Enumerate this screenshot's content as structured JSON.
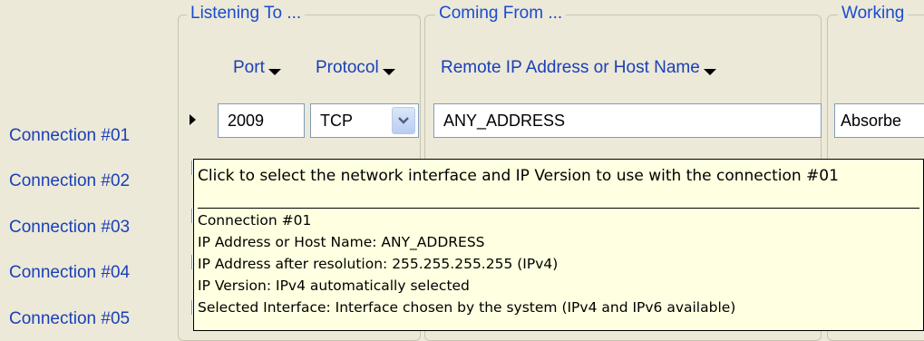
{
  "groups": {
    "listening": "Listening To ...",
    "coming_from": "Coming From ...",
    "working": "Working"
  },
  "columns": {
    "port": "Port",
    "protocol": "Protocol",
    "remote": "Remote IP Address or Host Name"
  },
  "rows": [
    "Connection #01",
    "Connection #02",
    "Connection #03",
    "Connection #04",
    "Connection #05"
  ],
  "row1": {
    "port": "2009",
    "protocol": "TCP",
    "remote": "ANY_ADDRESS",
    "working": "Absorbe"
  },
  "tooltip": {
    "title": "Click to select the network interface and IP Version to use with the connection #01",
    "lines": [
      "Connection #01",
      "IP Address or Host Name: ANY_ADDRESS",
      "IP Address after resolution: 255.255.255.255 (IPv4)",
      "IP Version: IPv4 automatically selected",
      "Selected Interface: Interface chosen by the system (IPv4 and IPv6 available)"
    ]
  },
  "colors": {
    "background": "#ece9d8",
    "label_blue": "#1a3fb8",
    "legend_blue": "#1a4bd1",
    "tooltip_bg": "#ffffe1"
  }
}
